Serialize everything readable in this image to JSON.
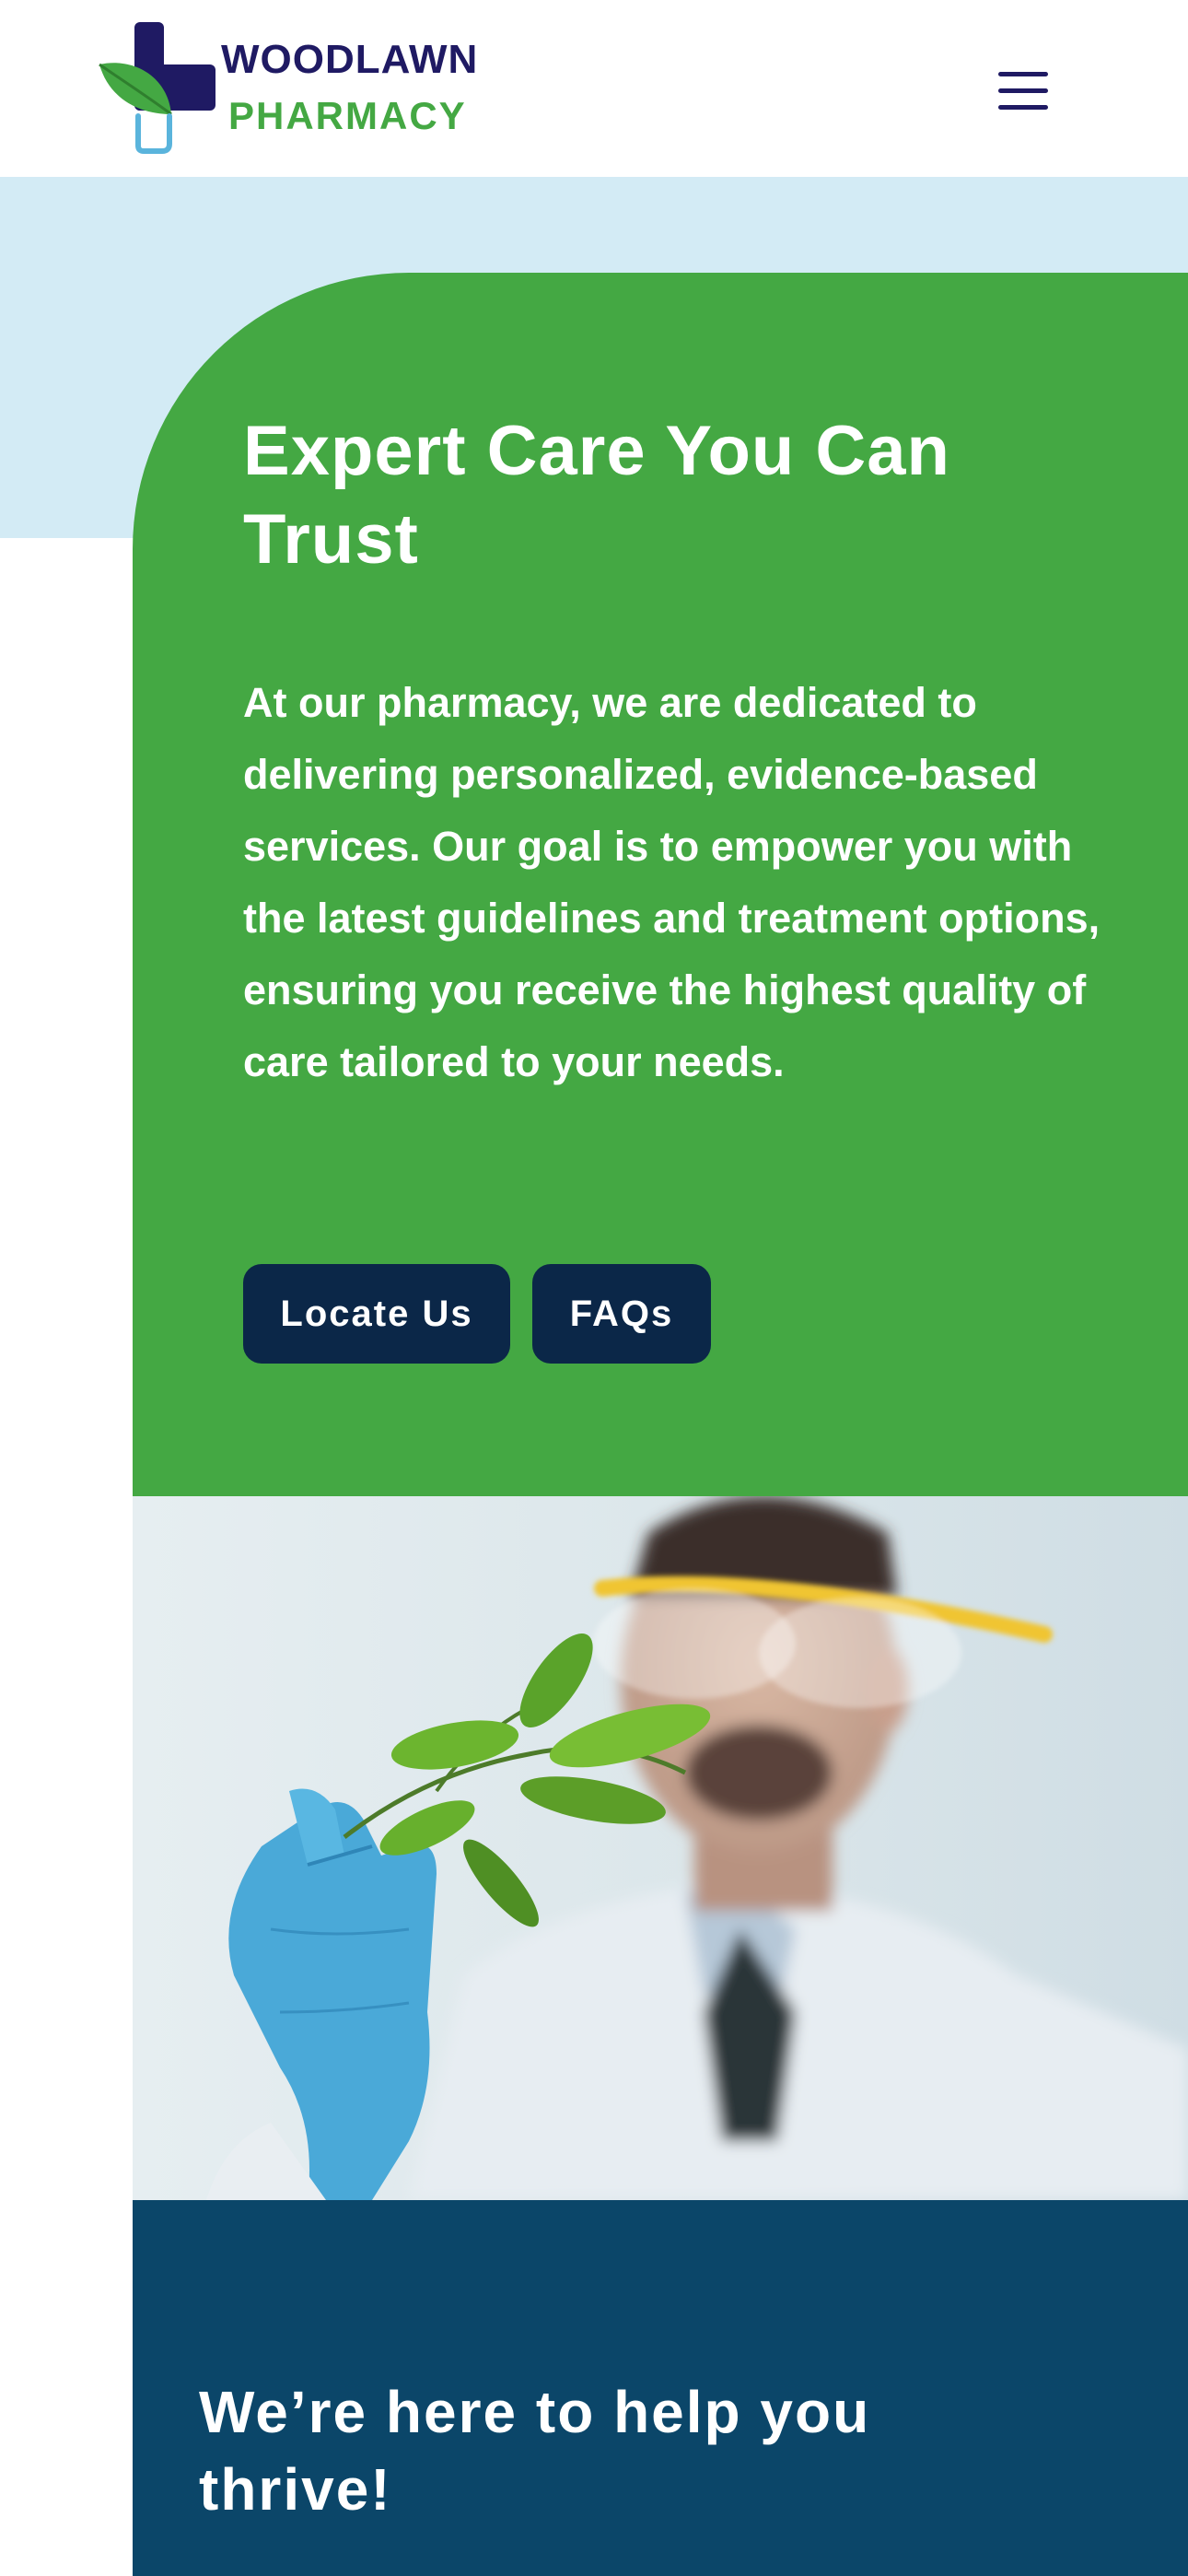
{
  "header": {
    "logo_line1": "WOODLAWN",
    "logo_line2": "PHARMACY",
    "menu_icon": "hamburger-menu-icon"
  },
  "hero": {
    "title": "Expert Care You Can Trust",
    "description": "At our pharmacy, we are dedicated to delivering personalized, evidence-based services. Our goal is to empower you with the latest guidelines and treatment options, ensuring you receive the highest quality of care tailored to your needs.",
    "buttons": {
      "locate": "Locate Us",
      "faqs": "FAQs"
    }
  },
  "help": {
    "title": "We’re here to help you thrive!"
  },
  "colors": {
    "brand_navy": "#1f1a63",
    "brand_green": "#44a843",
    "light_blue": "#d3ebf5",
    "button_navy": "#0b2748",
    "section_blue": "#0b4669"
  }
}
